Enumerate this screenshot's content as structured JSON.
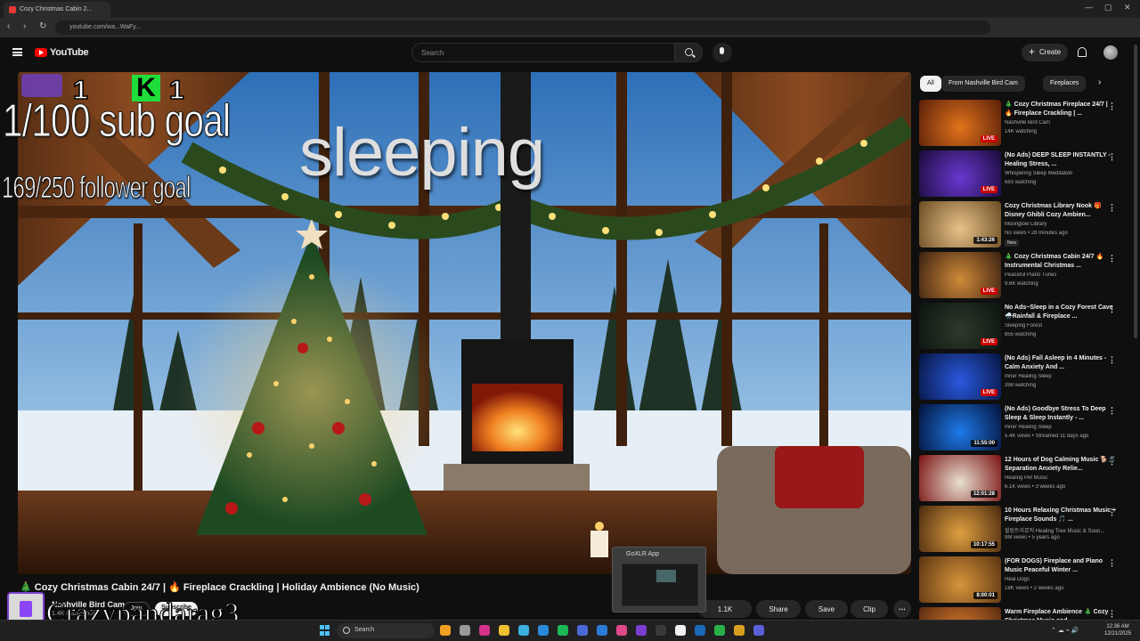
{
  "browser": {
    "tab_title": "Cozy Christmas Cabin 2...",
    "url": "youtube.com/wa...WaFy...",
    "window_controls": [
      "—",
      "▢",
      "✕"
    ]
  },
  "header": {
    "logo_text": "YouTube",
    "search_placeholder": "Search",
    "create_label": "Create"
  },
  "overlay": {
    "counter_a": "1",
    "k_badge": "K",
    "counter_b": "1",
    "sub_goal": "1/100 sub goal",
    "follower_goal": "169/250 follower goal",
    "status": "sleeping",
    "streamer_name": "Crazypandarag3"
  },
  "video": {
    "title": "🎄 Cozy Christmas Cabin 24/7 | 🔥 Fireplace Crackling | Holiday Ambience (No Music)",
    "channel": "Nashville Bird Cam",
    "subs": "1.4K subscribers",
    "join_label": "Join",
    "subscribe_label": "Subscribe",
    "like_count": "1.1K",
    "share_label": "Share",
    "save_label": "Save",
    "clip_label": "Clip",
    "more_label": "···"
  },
  "goxlr_popup": {
    "title": "GoXLR App"
  },
  "chips": [
    "All",
    "From Nashville Bird Cam",
    "Fireplaces"
  ],
  "recommendations": [
    {
      "title": "🎄 Cozy Christmas Fireplace 24/7 | 🔥 Fireplace Crackling | ...",
      "channel": "Nashville Bird Cam",
      "meta": "14K watching",
      "badge": "LIVE",
      "live": true,
      "colors": [
        "#5a1e08",
        "#e0741c"
      ]
    },
    {
      "title": "(No Ads) DEEP SLEEP INSTANTLY - Healing Stress, ...",
      "channel": "Whispering Sleep Meditation",
      "meta": "683 watching",
      "badge": "LIVE",
      "live": true,
      "colors": [
        "#1a0b3a",
        "#6a38d0"
      ]
    },
    {
      "title": "Cozy Christmas Library Nook 🎁Disney Ghibli Cozy Ambien...",
      "channel": "Moonglow Library",
      "meta": "No views • 28 minutes ago",
      "badge": "1:43:26",
      "live": false,
      "is_new": "New",
      "colors": [
        "#6a4a22",
        "#e8c48a"
      ]
    },
    {
      "title": "🎄 Cozy Christmas Cabin 24/7 🔥 Instrumental Christmas ...",
      "channel": "Peaceful Piano Tunes",
      "meta": "9.6K watching",
      "badge": "LIVE",
      "live": true,
      "colors": [
        "#3a2010",
        "#d08a3a"
      ]
    },
    {
      "title": "No Ads~Sleep in a Cozy Forest Cave🌧️Rainfall & Fireplace ...",
      "channel": "Sleeping Forest",
      "meta": "855 watching",
      "badge": "LIVE",
      "live": true,
      "colors": [
        "#0c1410",
        "#2c3a2a"
      ]
    },
    {
      "title": "(No Ads) Fall Asleep in 4 Minutes - Calm Anxiety And ...",
      "channel": "Inner Healing Sleep",
      "meta": "398 watching",
      "badge": "LIVE",
      "live": true,
      "colors": [
        "#061440",
        "#2a5ae0"
      ]
    },
    {
      "title": "(No Ads) Goodbye Stress To Deep Sleep & Sleep Instantly - ...",
      "channel": "Inner Healing Sleep",
      "meta": "5.4K views • Streamed 11 days ago",
      "badge": "11:55:00",
      "live": false,
      "colors": [
        "#04123a",
        "#1e7ae8"
      ]
    },
    {
      "title": "12 Hours of Dog Calming Music 🐕🎵 Separation Anxiety Relie...",
      "channel": "Healing Pet Music",
      "meta": "6.1K views • 3 weeks ago",
      "badge": "12:01:28",
      "live": false,
      "colors": [
        "#7a1010",
        "#e8e0d0"
      ]
    },
    {
      "title": "10 Hours Relaxing Christmas Music + Fireplace Sounds 🎵 ...",
      "channel": "힐링트리뮤직 Healing Tree Music & Soun...",
      "meta": "9M views • 5 years ago",
      "badge": "10:17:55",
      "live": false,
      "colors": [
        "#4a2a10",
        "#e0a040"
      ]
    },
    {
      "title": "(FOR DOGS) Fireplace and Piano Music Peaceful Winter ...",
      "channel": "Heal Dogs",
      "meta": "18K views • 2 weeks ago",
      "badge": "8:00:01",
      "live": false,
      "colors": [
        "#5a3412",
        "#d8943a"
      ]
    },
    {
      "title": "Warm Fireplace Ambience 🎄 Cozy Christmas Music and ...",
      "channel": "",
      "meta": "",
      "badge": "",
      "live": false,
      "colors": [
        "#5a2a10",
        "#e08030"
      ]
    }
  ],
  "taskbar": {
    "search_label": "Search",
    "time": "12:36 AM",
    "date": "12/21/2025",
    "app_colors": [
      "#f0a020",
      "#999",
      "#d6308a",
      "#f0c030",
      "#3ab0e0",
      "#2a8ad8",
      "#1db954",
      "#4a6ad8",
      "#2c7ad8",
      "#e04a8a",
      "#7a3fd0",
      "#3a3a3a",
      "#f1f1f1",
      "#1a6ab8",
      "#2ab04a",
      "#d8a020",
      "#5a60d8"
    ]
  },
  "colors": {
    "accent": "#ff0000",
    "live": "#cc0000",
    "k_badge": "#1fdd3a",
    "twitch": "#8c44f7"
  }
}
